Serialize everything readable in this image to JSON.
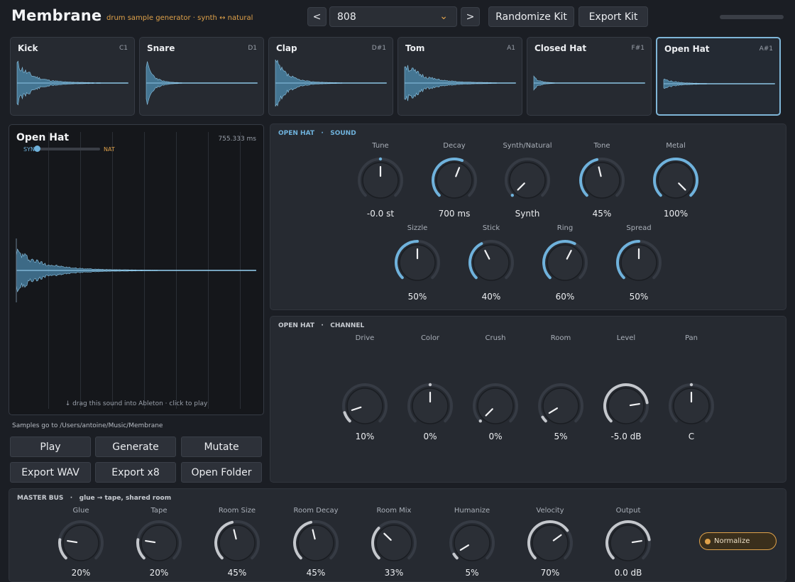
{
  "header": {
    "title": "Membrane",
    "subtitle": "drum sample generator  ·  synth ↔ natural",
    "prev_label": "<",
    "next_label": ">",
    "preset": "808",
    "randomize_label": "Randomize Kit",
    "export_label": "Export Kit"
  },
  "pads": [
    {
      "name": "Kick",
      "note": "C1",
      "active": false
    },
    {
      "name": "Snare",
      "note": "D1",
      "active": false
    },
    {
      "name": "Clap",
      "note": "D#1",
      "active": false
    },
    {
      "name": "Tom",
      "note": "A1",
      "active": false
    },
    {
      "name": "Closed Hat",
      "note": "F#1",
      "active": false
    },
    {
      "name": "Open Hat",
      "note": "A#1",
      "active": true
    }
  ],
  "preview": {
    "title": "Open Hat",
    "duration": "755.333 ms",
    "syn_label": "SYN",
    "nat_label": "NAT",
    "syn_nat_value": 0.0,
    "hint": "↓ drag this sound into Ableton  ·  click to play"
  },
  "samples_path": "Samples go to /Users/antoine/Music/Membrane",
  "actions": {
    "play": "Play",
    "generate": "Generate",
    "mutate": "Mutate",
    "export_wav": "Export WAV",
    "export_x8": "Export x8",
    "open_folder": "Open Folder"
  },
  "sound_panel": {
    "header_sound": "OPEN HAT",
    "header_section": "SOUND",
    "knobs": [
      {
        "label": "Tune",
        "value": "-0.0 st",
        "level": 0.5,
        "bipolar": true
      },
      {
        "label": "Decay",
        "value": "700 ms",
        "level": 0.58
      },
      {
        "label": "Synth/Natural",
        "value": "Synth",
        "level": 0.0
      },
      {
        "label": "Tone",
        "value": "45%",
        "level": 0.45
      },
      {
        "label": "Metal",
        "value": "100%",
        "level": 1.0
      },
      {
        "label": "Sizzle",
        "value": "50%",
        "level": 0.5
      },
      {
        "label": "Stick",
        "value": "40%",
        "level": 0.4
      },
      {
        "label": "Ring",
        "value": "60%",
        "level": 0.6
      },
      {
        "label": "Spread",
        "value": "50%",
        "level": 0.5
      }
    ]
  },
  "channel_panel": {
    "header_sound": "OPEN HAT",
    "header_section": "CHANNEL",
    "knobs": [
      {
        "label": "Drive",
        "value": "10%",
        "level": 0.1
      },
      {
        "label": "Color",
        "value": "0%",
        "level": 0.5,
        "bipolar": true
      },
      {
        "label": "Crush",
        "value": "0%",
        "level": 0.0
      },
      {
        "label": "Room",
        "value": "5%",
        "level": 0.05
      },
      {
        "label": "Level",
        "value": "-5.0 dB",
        "level": 0.8
      },
      {
        "label": "Pan",
        "value": "C",
        "level": 0.5,
        "bipolar": true
      }
    ]
  },
  "master_bus": {
    "header": "MASTER BUS",
    "desc": "glue → tape, shared room",
    "knobs": [
      {
        "label": "Glue",
        "value": "20%",
        "level": 0.2
      },
      {
        "label": "Tape",
        "value": "20%",
        "level": 0.2
      },
      {
        "label": "Room Size",
        "value": "45%",
        "level": 0.45
      },
      {
        "label": "Room Decay",
        "value": "45%",
        "level": 0.45
      },
      {
        "label": "Room Mix",
        "value": "33%",
        "level": 0.33
      },
      {
        "label": "Humanize",
        "value": "5%",
        "level": 0.05
      },
      {
        "label": "Velocity",
        "value": "70%",
        "level": 0.7
      },
      {
        "label": "Output",
        "value": "0.0 dB",
        "level": 0.8
      }
    ],
    "normalize_label": "Normalize"
  },
  "colors": {
    "accent_blue": "#6fb2dc",
    "accent_orange": "#e0a24a",
    "master_arc": "#c4c7cc"
  }
}
